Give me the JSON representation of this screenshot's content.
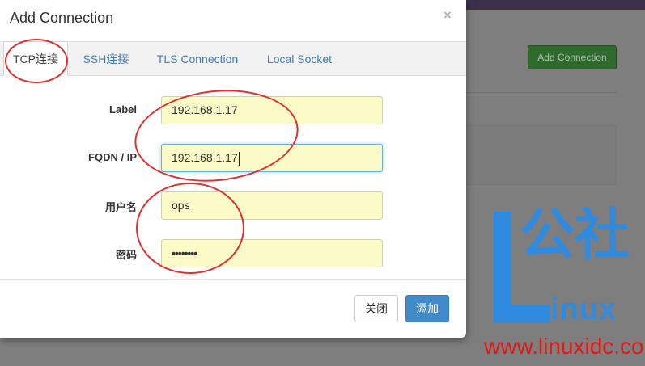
{
  "background_page": {
    "add_connection_button": "Add Connection"
  },
  "modal": {
    "title": "Add Connection",
    "close_glyph": "×",
    "tabs": [
      {
        "label": "TCP连接",
        "active": true
      },
      {
        "label": "SSH连接",
        "active": false
      },
      {
        "label": "TLS Connection",
        "active": false
      },
      {
        "label": "Local Socket",
        "active": false
      }
    ],
    "fields": {
      "label": {
        "label": "Label",
        "value": "192.168.1.17"
      },
      "fqdn": {
        "label": "FQDN / IP",
        "value": "192.168.1.17"
      },
      "username": {
        "label": "用户名",
        "value": "ops"
      },
      "password": {
        "label": "密码",
        "value": "••••••••"
      }
    },
    "buttons": {
      "close": "关闭",
      "add": "添加"
    }
  },
  "watermark": {
    "logo_text": "公社",
    "logo_letters": "inux",
    "url": "www.linuxidc.com"
  },
  "colors": {
    "primary": "#428bca",
    "input_autofill_bg": "#fafbc7",
    "annotation": "#e03030",
    "watermark_blue": "#2f8be0",
    "watermark_red": "#e01818",
    "success_dimmed": "#2e6a2e"
  }
}
